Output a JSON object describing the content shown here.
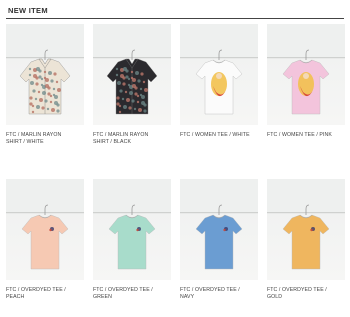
{
  "section": {
    "title": "NEW ITEM"
  },
  "products": [
    {
      "name_line1": "FTC / MARLIN RAYON",
      "name_line2": "SHIRT / WHITE",
      "garment": "shirt",
      "color": "#ece4d6",
      "pattern": "#b46b5c",
      "print": ""
    },
    {
      "name_line1": "FTC / MARLIN RAYON",
      "name_line2": "SHIRT / BLACK",
      "garment": "shirt",
      "color": "#2b2a2e",
      "pattern": "#c47c6f",
      "print": ""
    },
    {
      "name_line1": "FTC / WOMEN TEE / WHITE",
      "name_line2": "",
      "garment": "tee",
      "color": "#fbfbfb",
      "pattern": "",
      "print": "big"
    },
    {
      "name_line1": "FTC / WOMEN TEE / PINK",
      "name_line2": "",
      "garment": "tee",
      "color": "#f3c4dc",
      "pattern": "",
      "print": "big"
    },
    {
      "name_line1": "FTC / OVERDYED TEE /",
      "name_line2": "PEACH",
      "garment": "tee",
      "color": "#f6c9b3",
      "pattern": "",
      "print": "small"
    },
    {
      "name_line1": "FTC / OVERDYED TEE /",
      "name_line2": "GREEN",
      "garment": "tee",
      "color": "#a8dccb",
      "pattern": "",
      "print": "small"
    },
    {
      "name_line1": "FTC / OVERDYED TEE /",
      "name_line2": "NAVY",
      "garment": "tee",
      "color": "#6b9dd2",
      "pattern": "",
      "print": "small"
    },
    {
      "name_line1": "FTC / OVERDYED TEE /",
      "name_line2": "GOLD",
      "garment": "tee",
      "color": "#efb65f",
      "pattern": "",
      "print": "small"
    }
  ]
}
